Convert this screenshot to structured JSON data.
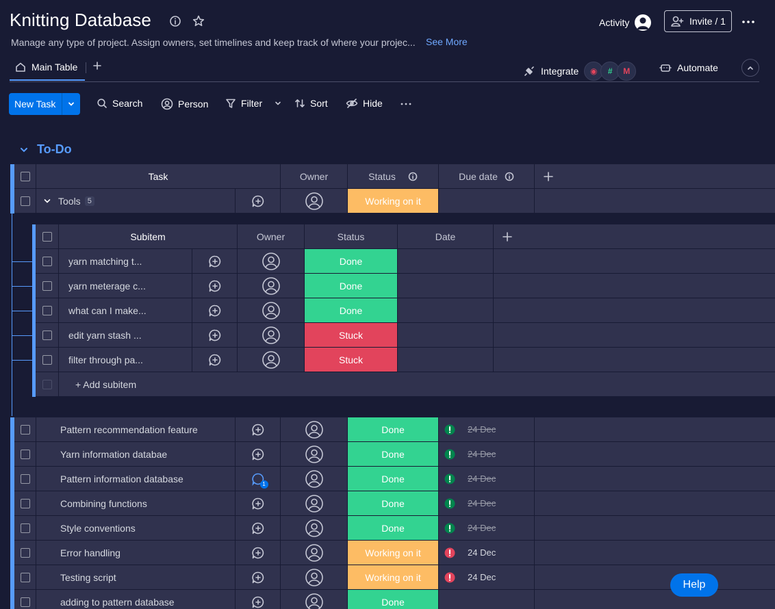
{
  "header": {
    "title": "Knitting Database",
    "description": "Manage any type of project. Assign owners, set timelines and keep track of where your projec...",
    "see_more": "See More",
    "activity": "Activity",
    "invite": "Invite / 1"
  },
  "tabs": {
    "main": "Main Table",
    "add": "+",
    "integrate": "Integrate",
    "automate": "Automate"
  },
  "toolbar": {
    "new_task": "New Task",
    "search": "Search",
    "person": "Person",
    "filter": "Filter",
    "sort": "Sort",
    "hide": "Hide"
  },
  "group": {
    "title": "To-Do"
  },
  "columns": {
    "task": "Task",
    "owner": "Owner",
    "status": "Status",
    "due_date": "Due date"
  },
  "parent_item": {
    "name": "Tools",
    "count": "5",
    "status": "Working on it"
  },
  "subcolumns": {
    "subitem": "Subitem",
    "owner": "Owner",
    "status": "Status",
    "date": "Date"
  },
  "subitems": [
    {
      "name": "yarn matching t...",
      "status": "Done"
    },
    {
      "name": "yarn meterage c...",
      "status": "Done"
    },
    {
      "name": "what can I make...",
      "status": "Done"
    },
    {
      "name": "edit yarn stash ...",
      "status": "Stuck"
    },
    {
      "name": "filter through pa...",
      "status": "Stuck"
    }
  ],
  "add_subitem": "+ Add subitem",
  "items": [
    {
      "name": "Pattern recommendation feature",
      "status": "Done",
      "date": "24 Dec"
    },
    {
      "name": "Yarn information databae",
      "status": "Done",
      "date": "24 Dec"
    },
    {
      "name": "Pattern information database",
      "status": "Done",
      "date": "24 Dec",
      "updates": "1"
    },
    {
      "name": "Combining functions",
      "status": "Done",
      "date": "24 Dec"
    },
    {
      "name": "Style conventions",
      "status": "Done",
      "date": "24 Dec"
    },
    {
      "name": "Error handling",
      "status": "Working on it",
      "date": "24 Dec"
    },
    {
      "name": "Testing script",
      "status": "Working on it",
      "date": "24 Dec"
    },
    {
      "name": "adding to pattern database",
      "status": "Done",
      "date": ""
    }
  ],
  "help": "Help",
  "colors": {
    "background": "#181b34",
    "row": "#30324e",
    "accent": "#579bfc",
    "done": "#33d391",
    "working": "#fdbc64",
    "stuck": "#e2445c",
    "primary_button": "#0073ea"
  }
}
